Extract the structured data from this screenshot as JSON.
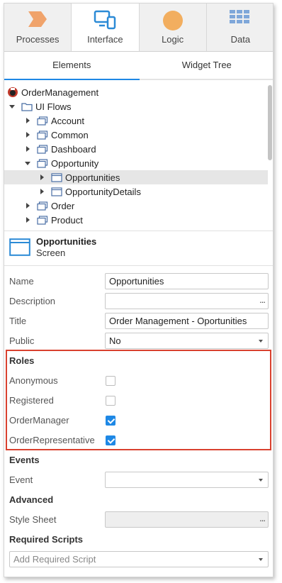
{
  "tabs": [
    {
      "label": "Processes",
      "icon": "processes-icon",
      "color": "#f0a36b"
    },
    {
      "label": "Interface",
      "icon": "interface-icon",
      "color": "#2b8ad6"
    },
    {
      "label": "Logic",
      "icon": "logic-icon",
      "color": "#f2ae5f"
    },
    {
      "label": "Data",
      "icon": "data-icon",
      "color": "#7fa7d9"
    }
  ],
  "active_tab": "Interface",
  "subtabs": [
    "Elements",
    "Widget Tree"
  ],
  "active_subtab": "Elements",
  "tree": {
    "root": "OrderManagement",
    "ui_flows": "UI Flows",
    "items": [
      "Account",
      "Common",
      "Dashboard",
      "Opportunity",
      "Opportunities",
      "OpportunityDetails",
      "Order",
      "Product"
    ]
  },
  "selected": {
    "name": "Opportunities",
    "type": "Screen"
  },
  "properties": {
    "name_label": "Name",
    "name_value": "Opportunities",
    "description_label": "Description",
    "description_value": "",
    "title_label": "Title",
    "title_value": "Order Management  - Oportunities",
    "public_label": "Public",
    "public_value": "No",
    "ellipsis": "..."
  },
  "roles": {
    "heading": "Roles",
    "items": [
      {
        "label": "Anonymous",
        "checked": false
      },
      {
        "label": "Registered",
        "checked": false
      },
      {
        "label": "OrderManager",
        "checked": true
      },
      {
        "label": "OrderRepresentative",
        "checked": true
      }
    ]
  },
  "events": {
    "heading": "Events",
    "event_label": "Event",
    "event_value": ""
  },
  "advanced": {
    "heading": "Advanced",
    "style_sheet_label": "Style Sheet",
    "style_sheet_value": ""
  },
  "required_scripts": {
    "heading": "Required Scripts",
    "placeholder": "Add Required Script"
  },
  "colors": {
    "accent": "#1e88e5",
    "highlight_border": "#d9412f",
    "folder": "#4a6fa5",
    "selected_row": "#e6e6e6"
  }
}
